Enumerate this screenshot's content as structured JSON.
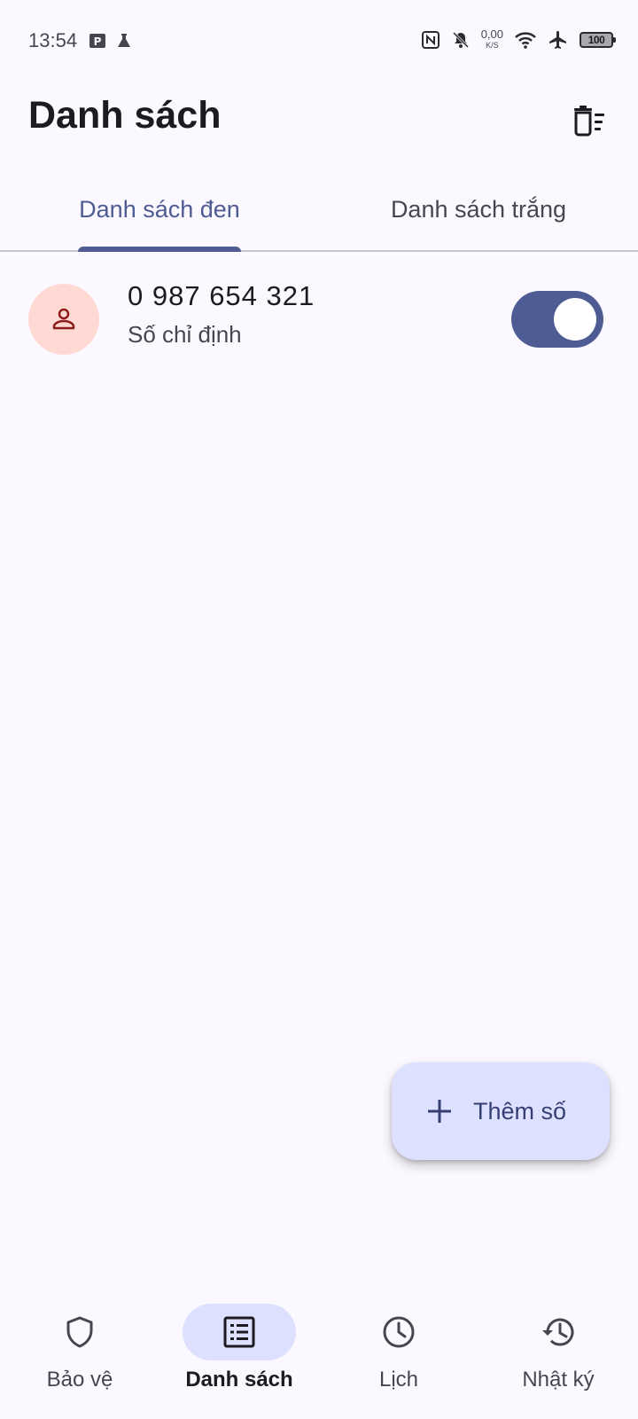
{
  "status_bar": {
    "time": "13:54",
    "speed_value": "0,00",
    "speed_unit": "K/S",
    "battery": "100"
  },
  "app_bar": {
    "title": "Danh sách"
  },
  "tabs": [
    {
      "label": "Danh sách đen",
      "active": true
    },
    {
      "label": "Danh sách trắng",
      "active": false
    }
  ],
  "list": [
    {
      "number": "0 987 654 321",
      "subtitle": "Số chỉ định",
      "enabled": true
    }
  ],
  "fab": {
    "label": "Thêm số"
  },
  "bottom_nav": [
    {
      "label": "Bảo vệ",
      "icon": "shield-icon",
      "active": false
    },
    {
      "label": "Danh sách",
      "icon": "list-icon",
      "active": true
    },
    {
      "label": "Lịch",
      "icon": "clock-icon",
      "active": false
    },
    {
      "label": "Nhật ký",
      "icon": "history-icon",
      "active": false
    }
  ],
  "colors": {
    "primary": "#4f5b93",
    "background": "#fbf8ff",
    "avatar_bg": "#ffdad5",
    "avatar_icon": "#8c1d18",
    "fab_bg": "#dde1ff"
  }
}
